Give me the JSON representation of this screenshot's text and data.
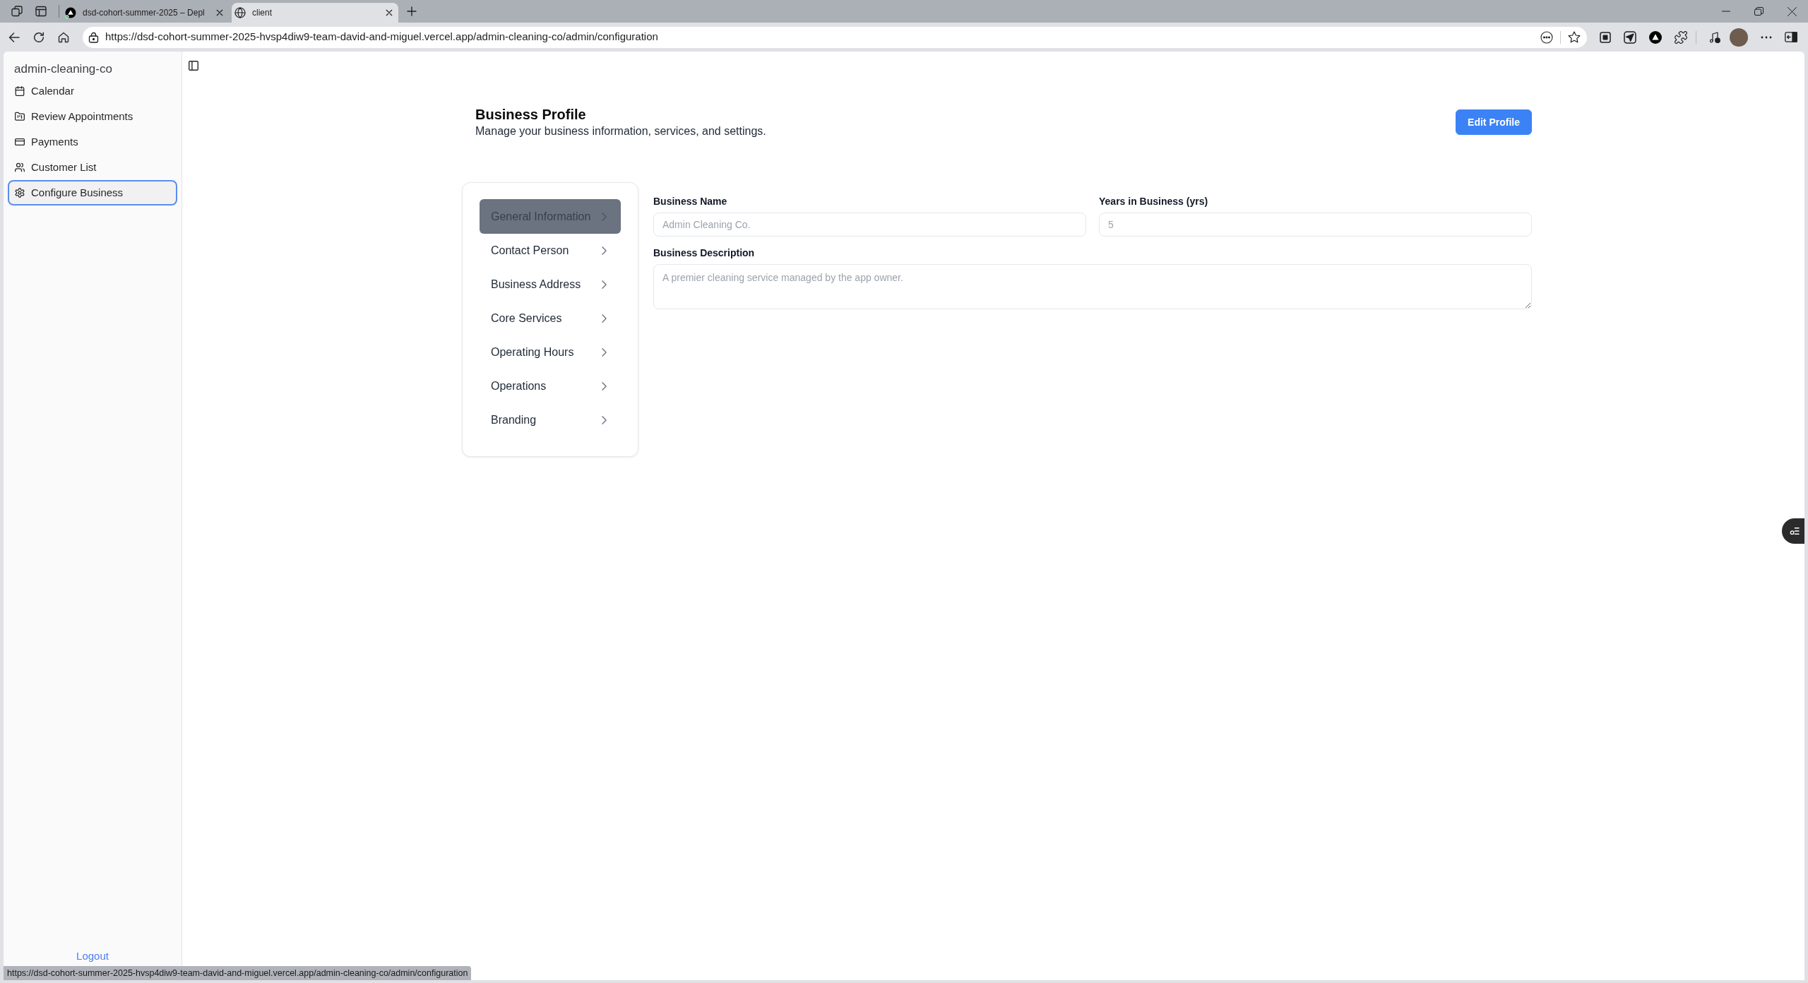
{
  "browser": {
    "tabs": [
      {
        "title": "dsd-cohort-summer-2025 – Depl",
        "selected": false
      },
      {
        "title": "client",
        "selected": true
      }
    ],
    "address": "https://dsd-cohort-summer-2025-hvsp4diw9-team-david-and-miguel.vercel.app/admin-cleaning-co/admin/configuration"
  },
  "sidebar": {
    "title": "admin-cleaning-co",
    "items": [
      {
        "label": "Calendar",
        "selected": false
      },
      {
        "label": "Review Appointments",
        "selected": false
      },
      {
        "label": "Payments",
        "selected": false
      },
      {
        "label": "Customer List",
        "selected": false
      },
      {
        "label": "Configure Business",
        "selected": true
      }
    ],
    "logout": "Logout"
  },
  "header": {
    "title": "Business Profile",
    "subtitle": "Manage your business information, services, and settings.",
    "edit_button": "Edit Profile"
  },
  "section_nav": {
    "items": [
      {
        "label": "General Information",
        "selected": true
      },
      {
        "label": "Contact Person",
        "selected": false
      },
      {
        "label": "Business Address",
        "selected": false
      },
      {
        "label": "Core Services",
        "selected": false
      },
      {
        "label": "Operating Hours",
        "selected": false
      },
      {
        "label": "Operations",
        "selected": false
      },
      {
        "label": "Branding",
        "selected": false
      }
    ]
  },
  "form": {
    "fields": [
      {
        "kind": "input",
        "label": "Business Name",
        "value": "Admin Cleaning Co.",
        "disabled": true
      },
      {
        "kind": "input",
        "label": "Years in Business (yrs)",
        "value": "5",
        "disabled": true
      },
      {
        "kind": "textarea",
        "label": "Business Description",
        "value": "A premier cleaning service managed by the app owner.",
        "disabled": true
      }
    ]
  },
  "status_bar": {
    "link_preview": "https://dsd-cohort-summer-2025-hvsp4diw9-team-david-and-miguel.vercel.app/admin-cleaning-co/admin/configuration"
  }
}
